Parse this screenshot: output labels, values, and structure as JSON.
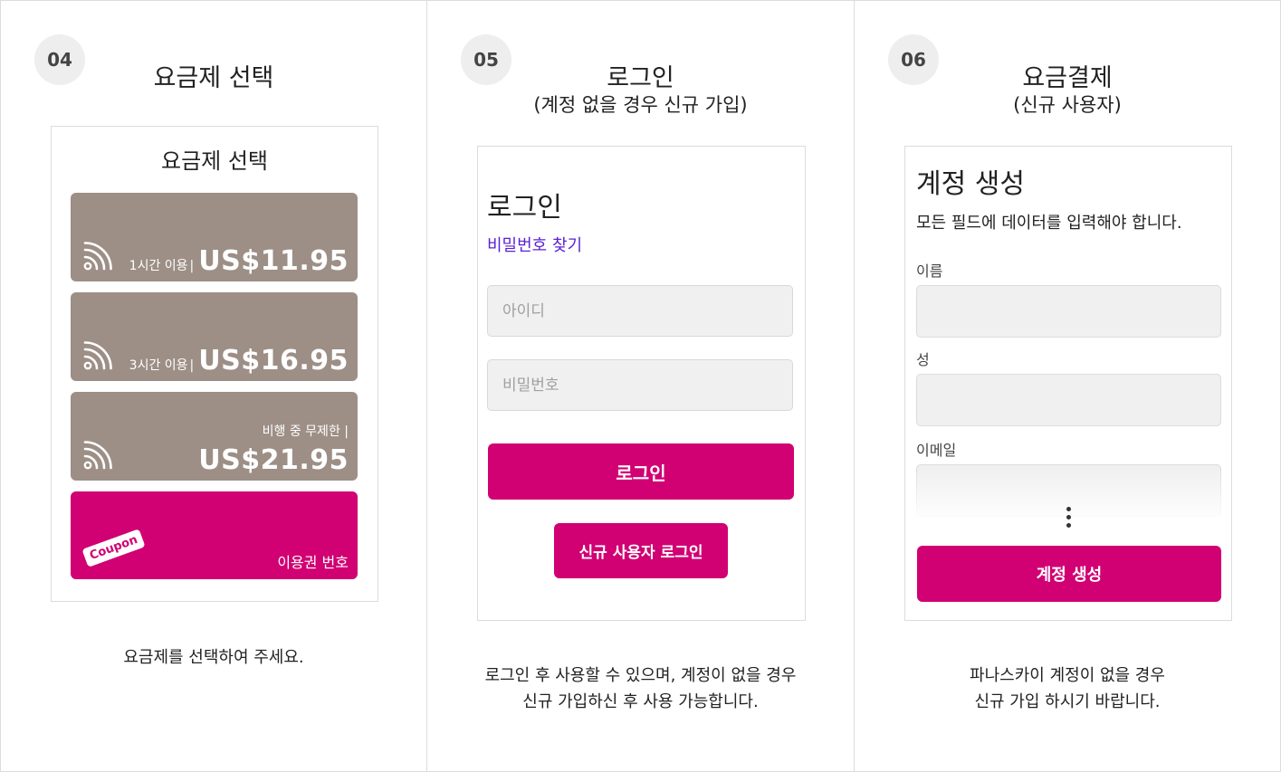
{
  "steps": [
    {
      "number": "04",
      "title": "요금제 선택",
      "phone": {
        "title": "요금제 선택",
        "plans": [
          {
            "icon": "wifi-icon",
            "label": "1시간 이용",
            "separator": "|",
            "price": "US$11.95"
          },
          {
            "icon": "wifi-icon",
            "label": "3시간 이용",
            "separator": "|",
            "price": "US$16.95"
          },
          {
            "icon": "wifi-icon",
            "label": "비행 중 무제한 |",
            "price": "US$21.95"
          }
        ],
        "coupon": {
          "tag": "Coupon",
          "label": "이용권 번호"
        }
      },
      "description": [
        "요금제를 선택하여 주세요."
      ]
    },
    {
      "number": "05",
      "title": "로그인",
      "subtitle": "(계정 없을 경우 신규 가입)",
      "phone": {
        "title": "로그인",
        "forgot_password": "비밀번호 찾기",
        "id_placeholder": "아이디",
        "password_placeholder": "비밀번호",
        "login_button": "로그인",
        "new_user_button": "신규 사용자 로그인"
      },
      "description": [
        "로그인 후 사용할 수 있으며, 계정이 없을 경우",
        "신규 가입하신 후 사용 가능합니다."
      ]
    },
    {
      "number": "06",
      "title": "요금결제",
      "subtitle": "(신규 사용자)",
      "phone": {
        "title": "계정 생성",
        "note": "모든 필드에 데이터를 입력해야 합니다.",
        "fields": [
          "이름",
          "성",
          "이메일"
        ],
        "create_button": "계정 생성"
      },
      "description": [
        "파나스카이 계정이 없을 경우",
        "신규 가입 하시기 바랍니다."
      ]
    }
  ],
  "colors": {
    "accent": "#d10073",
    "plan_card": "#9d8f86",
    "link": "#5a1fd6",
    "step_badge": "#eeeeee",
    "input_bg": "#f0f0f0"
  }
}
